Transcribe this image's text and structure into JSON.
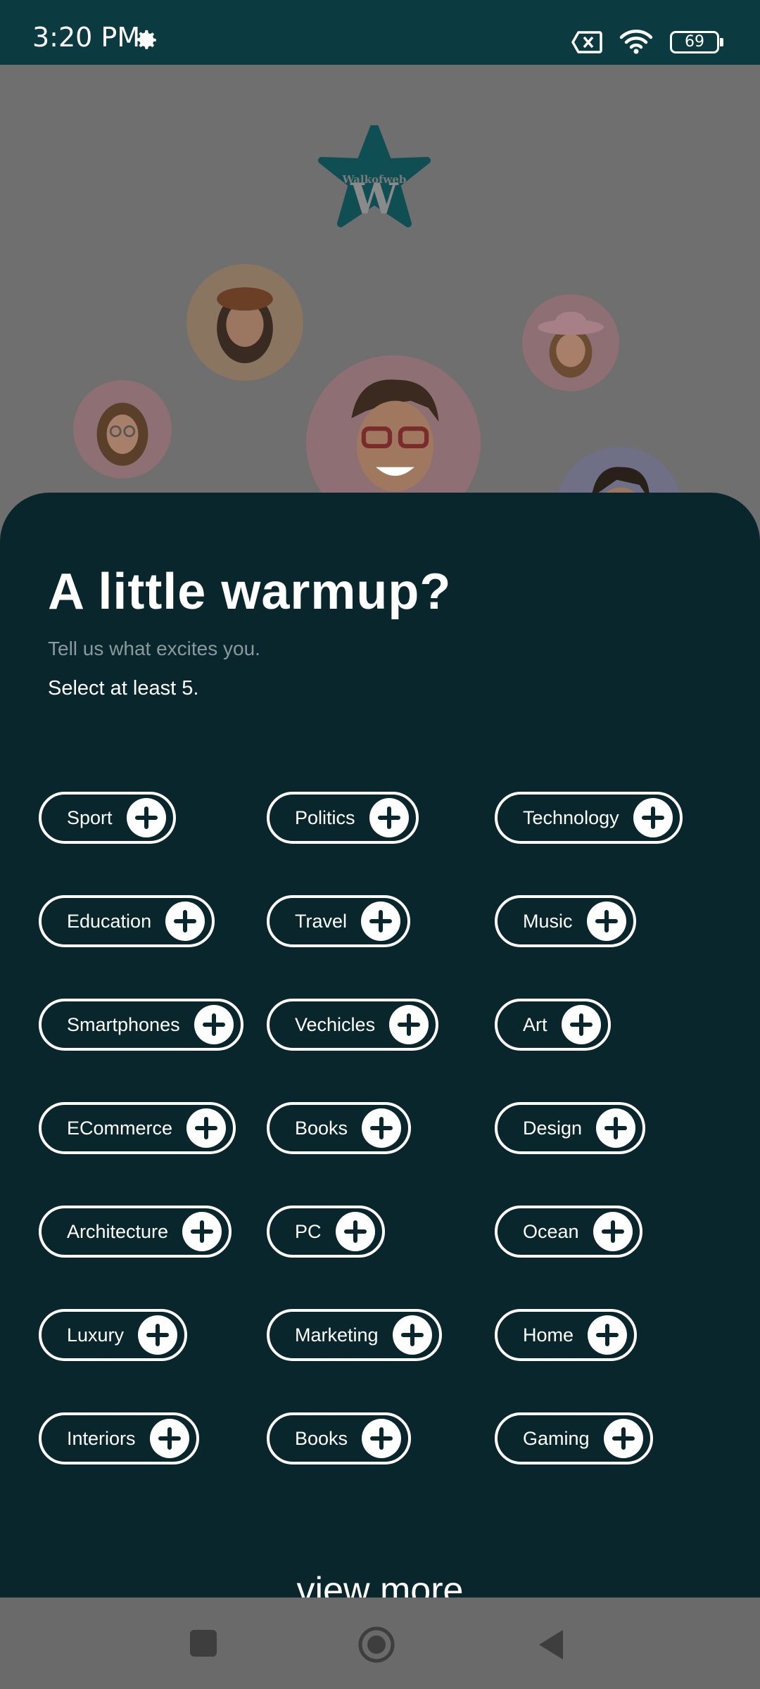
{
  "status": {
    "time": "3:20 PM",
    "battery": "69"
  },
  "logo": {
    "text": "Walkofweb",
    "letter": "W"
  },
  "warmup": {
    "title": "A little warmup?",
    "subtitle": "Tell us what excites you.",
    "instruction": "Select at least 5."
  },
  "interests": [
    "Sport",
    "Politics",
    "Technology",
    "Education",
    "Travel",
    "Music",
    "Smartphones",
    "Vechicles",
    "Art",
    "ECommerce",
    "Books",
    "Design",
    "Architecture",
    "PC",
    "Ocean",
    "Luxury",
    "Marketing",
    "Home",
    "Interiors",
    "Books",
    "Gaming"
  ],
  "view_more_label": "view more",
  "colors": {
    "status_bar": "#0b3a40",
    "sheet": "#08262b",
    "chip_border": "#ffffff",
    "dim_overlay": "#6f6f6f"
  }
}
